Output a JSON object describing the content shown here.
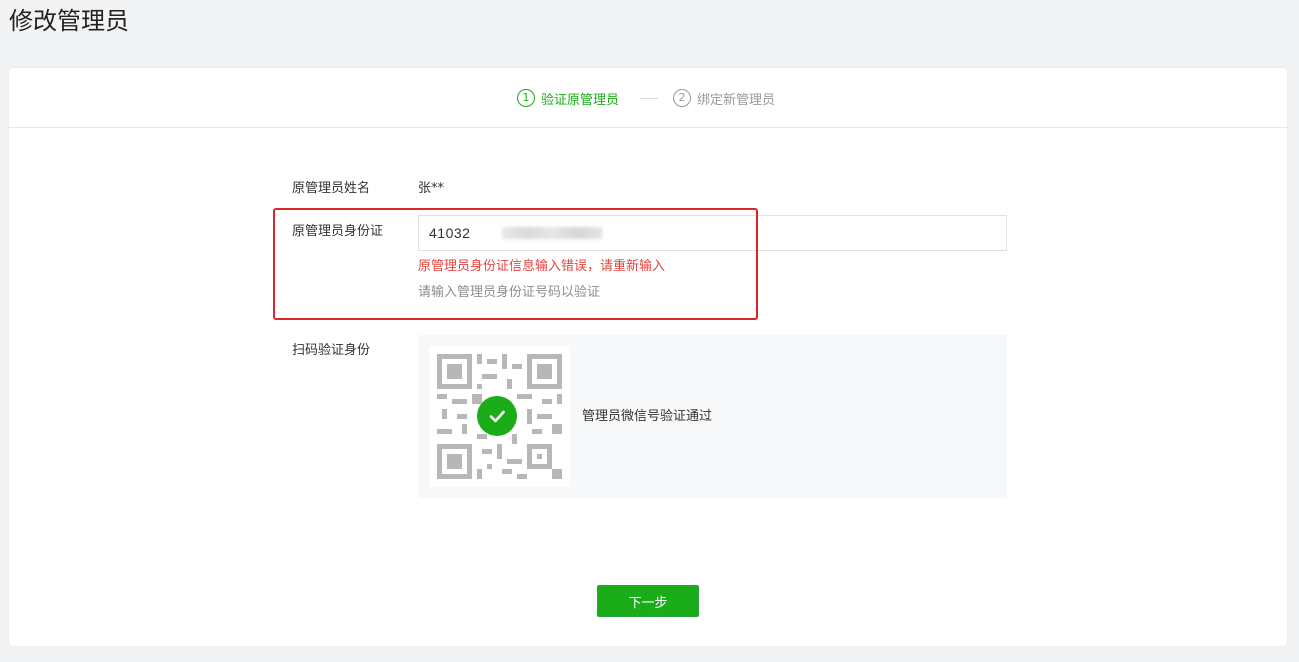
{
  "page": {
    "title": "修改管理员"
  },
  "steps": [
    {
      "number": "1",
      "label": "验证原管理员",
      "state": "active"
    },
    {
      "number": "2",
      "label": "绑定新管理员",
      "state": "inactive"
    }
  ],
  "form": {
    "name": {
      "label": "原管理员姓名",
      "value": "张**"
    },
    "id_card": {
      "label": "原管理员身份证",
      "value_visible": "41032",
      "error": "原管理员身份证信息输入错误，请重新输入",
      "hint": "请输入管理员身份证号码以验证"
    },
    "scan": {
      "label": "扫码验证身份",
      "status": "管理员微信号验证通过"
    }
  },
  "actions": {
    "next_label": "下一步"
  },
  "colors": {
    "primary": "#1aad19",
    "error": "#e64340",
    "highlight_border": "#d9262c",
    "hint": "#8d8d8d",
    "panel_bg": "#f6f8f9"
  },
  "icons": {
    "qr": "qr-code-icon",
    "check": "check-circle-icon"
  }
}
